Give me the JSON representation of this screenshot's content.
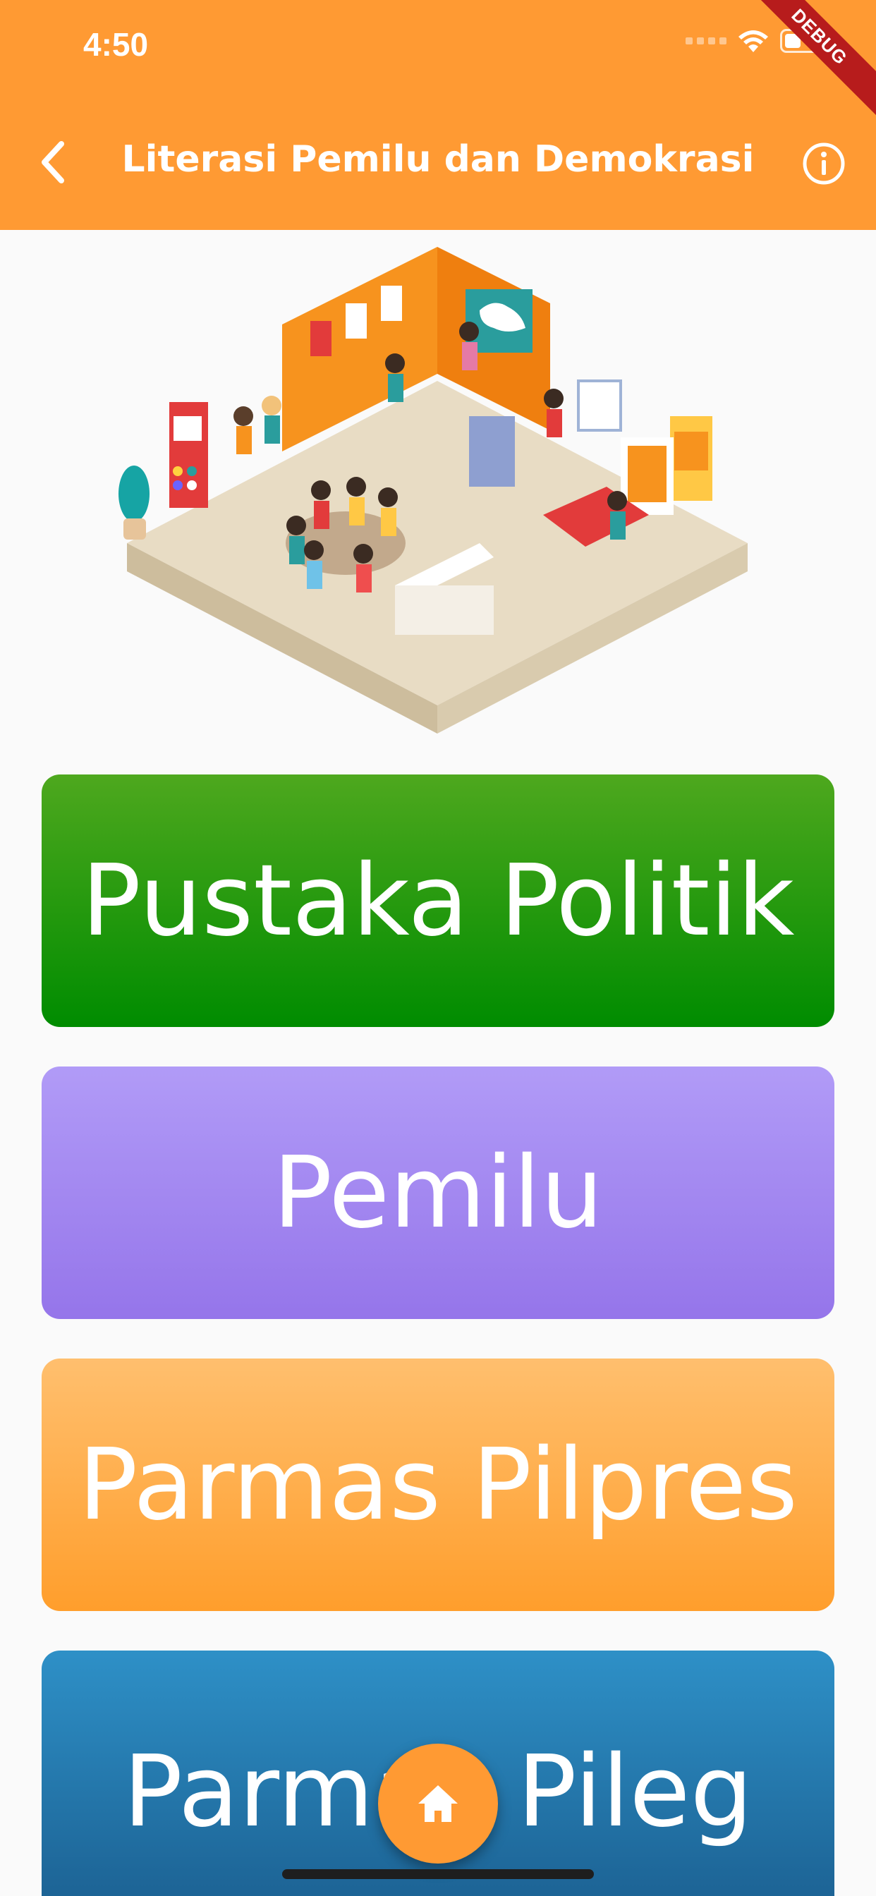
{
  "status_bar": {
    "time": "4:50"
  },
  "debug_banner": "DEBUG",
  "app_bar": {
    "title": "Literasi Pemilu dan Demokrasi"
  },
  "menu": [
    {
      "label": "Pustaka Politik",
      "color": "#0a8f00"
    },
    {
      "label": "Pemilu",
      "color": "#9b7cec"
    },
    {
      "label": "Parmas Pilpres",
      "color": "#ffa33a"
    },
    {
      "label": "Parmas Pileg",
      "color": "#2476ad"
    }
  ],
  "icons": {
    "back": "chevron-left-icon",
    "info": "info-circle-icon",
    "home": "home-icon"
  },
  "accent": "#ff9a33"
}
